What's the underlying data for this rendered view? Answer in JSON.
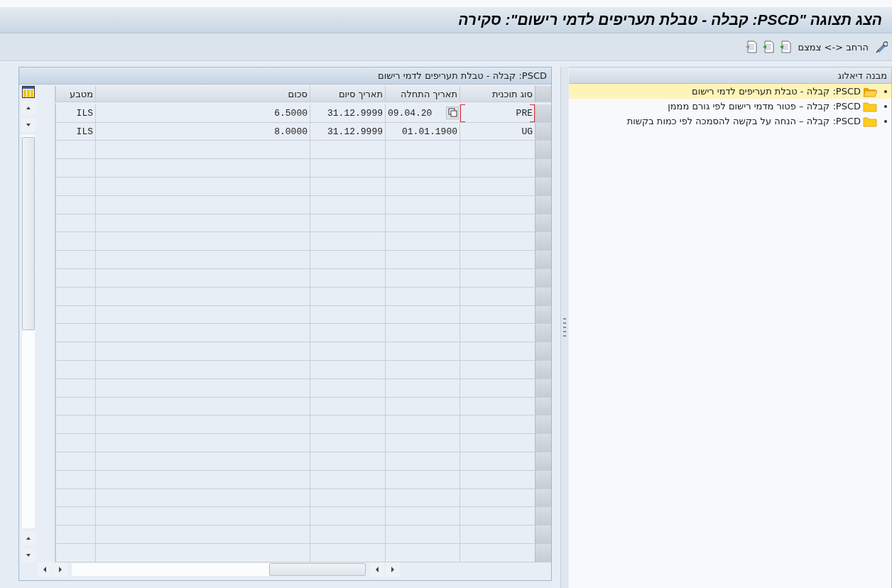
{
  "window": {
    "title": "הצג תצוגה \"PSCD: קבלה - טבלת תעריפים לדמי רישום\": סקירה"
  },
  "toolbar": {
    "toggle_label": "הרחב <-> צמצם"
  },
  "tree": {
    "title": "מבנה דיאלוג",
    "items": [
      {
        "label": "PSCD: קבלה - טבלת תעריפים לדמי רישום",
        "selected": true
      },
      {
        "label": "PSCD: קבלה – פטור מדמי רישום לפי גורם מממן",
        "selected": false
      },
      {
        "label": "PSCD: קבלה – הנחה על בקשה להסמכה לפי כמות בקשות",
        "selected": false
      }
    ]
  },
  "table": {
    "title": "PSCD: קבלה - טבלת תעריפים לדמי רישום",
    "columns": [
      "סוג תוכנית",
      "תאריך התחלה",
      "תאריך סיום",
      "סכום",
      "מטבע"
    ],
    "rows": [
      {
        "cells": [
          "PRE",
          "09.04.20",
          "31.12.9999",
          "6.5000",
          "ILS"
        ],
        "focused": true
      },
      {
        "cells": [
          "UG",
          "01.01.1900",
          "31.12.9999",
          "8.0000",
          "ILS"
        ],
        "focused": false
      }
    ]
  }
}
